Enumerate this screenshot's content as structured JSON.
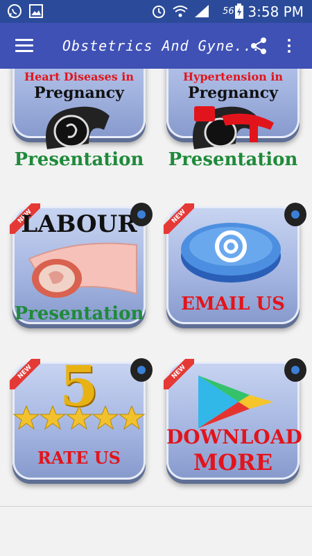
{
  "status": {
    "time": "3:58 PM",
    "battery_pct": "56%"
  },
  "app_bar": {
    "title": "Obstetrics And Gyne..."
  },
  "tiles": [
    {
      "line1": "Heart Diseases in",
      "line2": "Pregnancy",
      "line3": "Presentation"
    },
    {
      "line1": "Hypertension in",
      "line2": "Pregnancy",
      "line3": "Presentation"
    },
    {
      "line1": "LABOUR",
      "line3": "Presentation"
    },
    {
      "line3": "EMAIL  US"
    },
    {
      "big": "5",
      "line3": "RATE  US"
    },
    {
      "line2": "DOWNLOAD",
      "line3": "MORE"
    }
  ],
  "ribbon": {
    "label": "NEW"
  },
  "colors": {
    "status_bar": "#2b4b9a",
    "app_bar": "#3f51b5",
    "tile_red": "#e2141b",
    "tile_green": "#1f8a3a"
  }
}
